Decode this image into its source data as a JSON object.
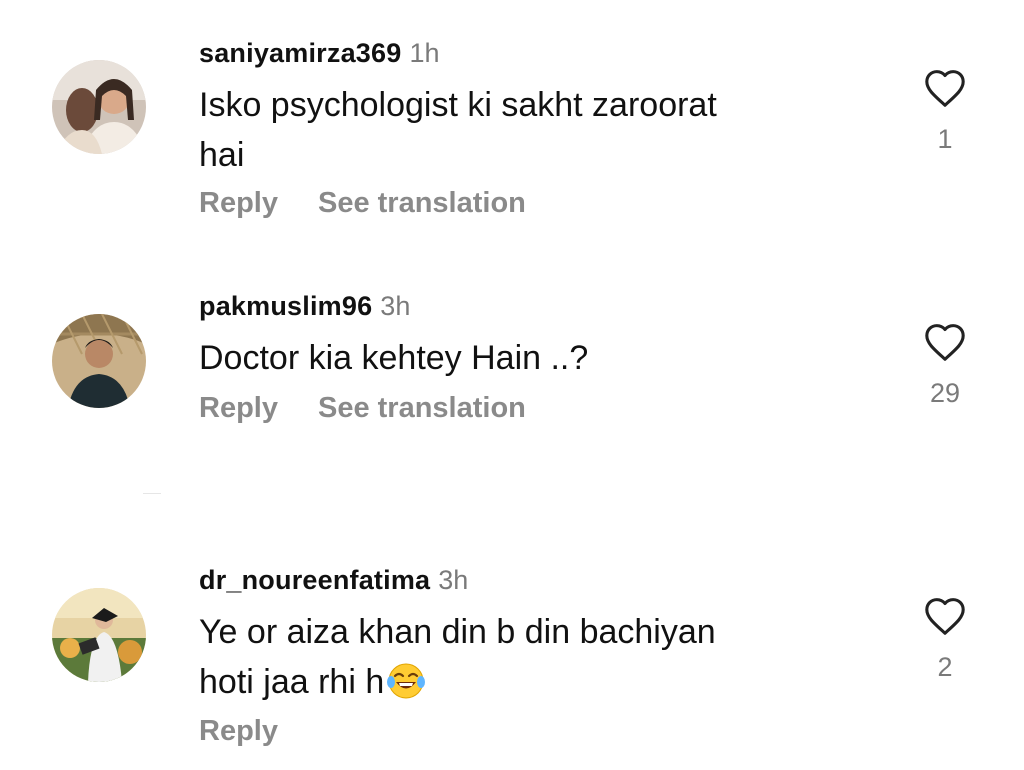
{
  "comments": [
    {
      "username": "saniyamirza369",
      "time": "1h",
      "text_lines": [
        "Isko psychologist ki sakht zaroorat",
        "hai"
      ],
      "reply_label": "Reply",
      "translate_label": "See translation",
      "likes": "1",
      "avatar_icon": "avatar-photo-woman"
    },
    {
      "username": "pakmuslim96",
      "time": "3h",
      "text_lines": [
        "Doctor kia kehtey Hain ..?"
      ],
      "reply_label": "Reply",
      "translate_label": "See translation",
      "likes": "29",
      "avatar_icon": "avatar-photo-man"
    },
    {
      "username": "dr_noureenfatima",
      "time": "3h",
      "text_lines": [
        "Ye or aiza khan din b din bachiyan",
        "hoti jaa rhi h"
      ],
      "emoji": "face-with-tears-of-joy",
      "reply_label": "Reply",
      "likes": "2",
      "avatar_icon": "avatar-photo-graduate"
    }
  ],
  "colors": {
    "text": "#111111",
    "muted": "#7a7a7a",
    "action": "#8a8a8a",
    "heart_stroke": "#222222"
  }
}
